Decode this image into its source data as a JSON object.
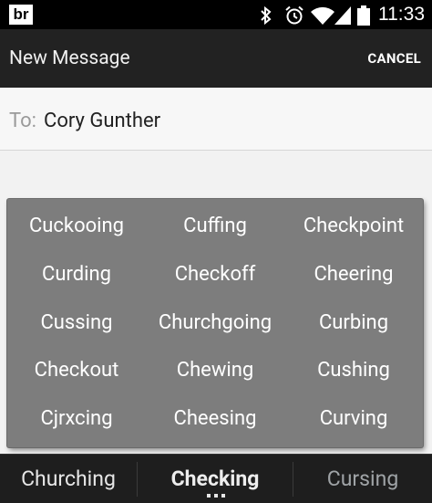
{
  "status_bar": {
    "logo_text": "br",
    "time": "11:33",
    "icons": [
      "bluetooth-icon",
      "alarm-icon",
      "wifi-icon",
      "signal-icon",
      "battery-icon"
    ]
  },
  "action_bar": {
    "title": "New Message",
    "cancel_label": "CANCEL"
  },
  "recipient": {
    "label": "To:",
    "value": "Cory Gunther"
  },
  "suggestion_popup": {
    "rows": [
      [
        "Cuckooing",
        "Cuffing",
        "Checkpoint"
      ],
      [
        "Curding",
        "Checkoff",
        "Cheering"
      ],
      [
        "Cussing",
        "Churchgoing",
        "Curbing"
      ],
      [
        "Checkout",
        "Chewing",
        "Cushing"
      ],
      [
        "Cjrxcing",
        "Cheesing",
        "Curving"
      ]
    ]
  },
  "suggestion_bar": {
    "left": "Churching",
    "center": "Checking",
    "right": "Cursing",
    "more_indicator": "more-dots-icon"
  },
  "colors": {
    "status_bar": "#000000",
    "action_bar": "#222222",
    "popup": "#7d7d7d",
    "suggestion_bar": "#1e1e1e"
  }
}
